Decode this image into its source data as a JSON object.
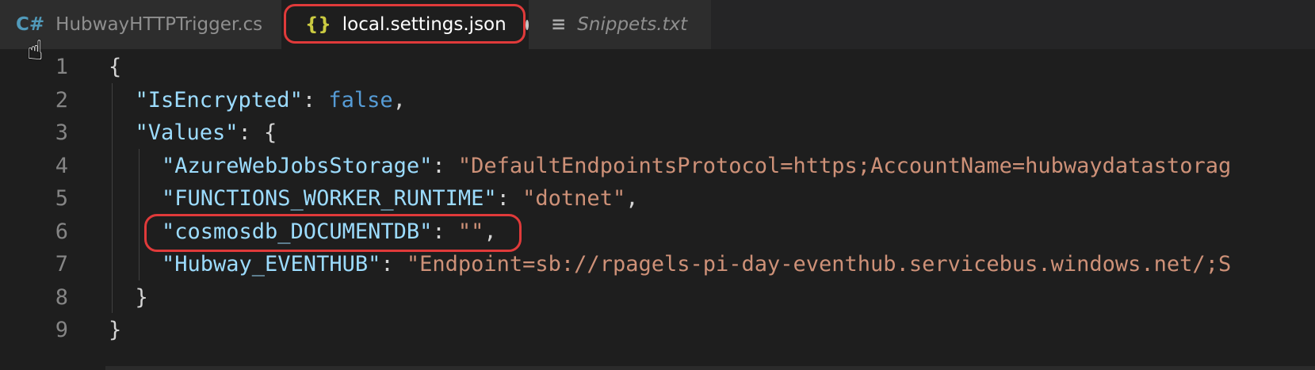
{
  "tabs": [
    {
      "label": "HubwayHTTPTrigger.cs",
      "icon": "C#"
    },
    {
      "label": "local.settings.json",
      "icon": "{}",
      "active": true,
      "modified": true
    },
    {
      "label": "Snippets.txt",
      "icon": "≡"
    }
  ],
  "lines": [
    {
      "n": "1",
      "a": "{"
    },
    {
      "n": "2",
      "k": "\"IsEncrypted\"",
      "c": ": ",
      "v": "false",
      "e": ","
    },
    {
      "n": "3",
      "k": "\"Values\"",
      "c": ": {"
    },
    {
      "n": "4",
      "k": "\"AzureWebJobsStorage\"",
      "c": ": ",
      "s": "\"DefaultEndpointsProtocol=https;AccountName=hubwaydatastorag"
    },
    {
      "n": "5",
      "k": "\"FUNCTIONS_WORKER_RUNTIME\"",
      "c": ": ",
      "s": "\"dotnet\"",
      "e": ","
    },
    {
      "n": "6",
      "k": "\"cosmosdb_DOCUMENTDB\"",
      "c": ": ",
      "s": "\"\"",
      "e": ","
    },
    {
      "n": "7",
      "k": "\"Hubway_EVENTHUB\"",
      "c": ": ",
      "s": "\"Endpoint=sb://rpagels-pi-day-eventhub.servicebus.windows.net/;S"
    },
    {
      "n": "8",
      "a": "}"
    },
    {
      "n": "9",
      "a": "}"
    }
  ]
}
